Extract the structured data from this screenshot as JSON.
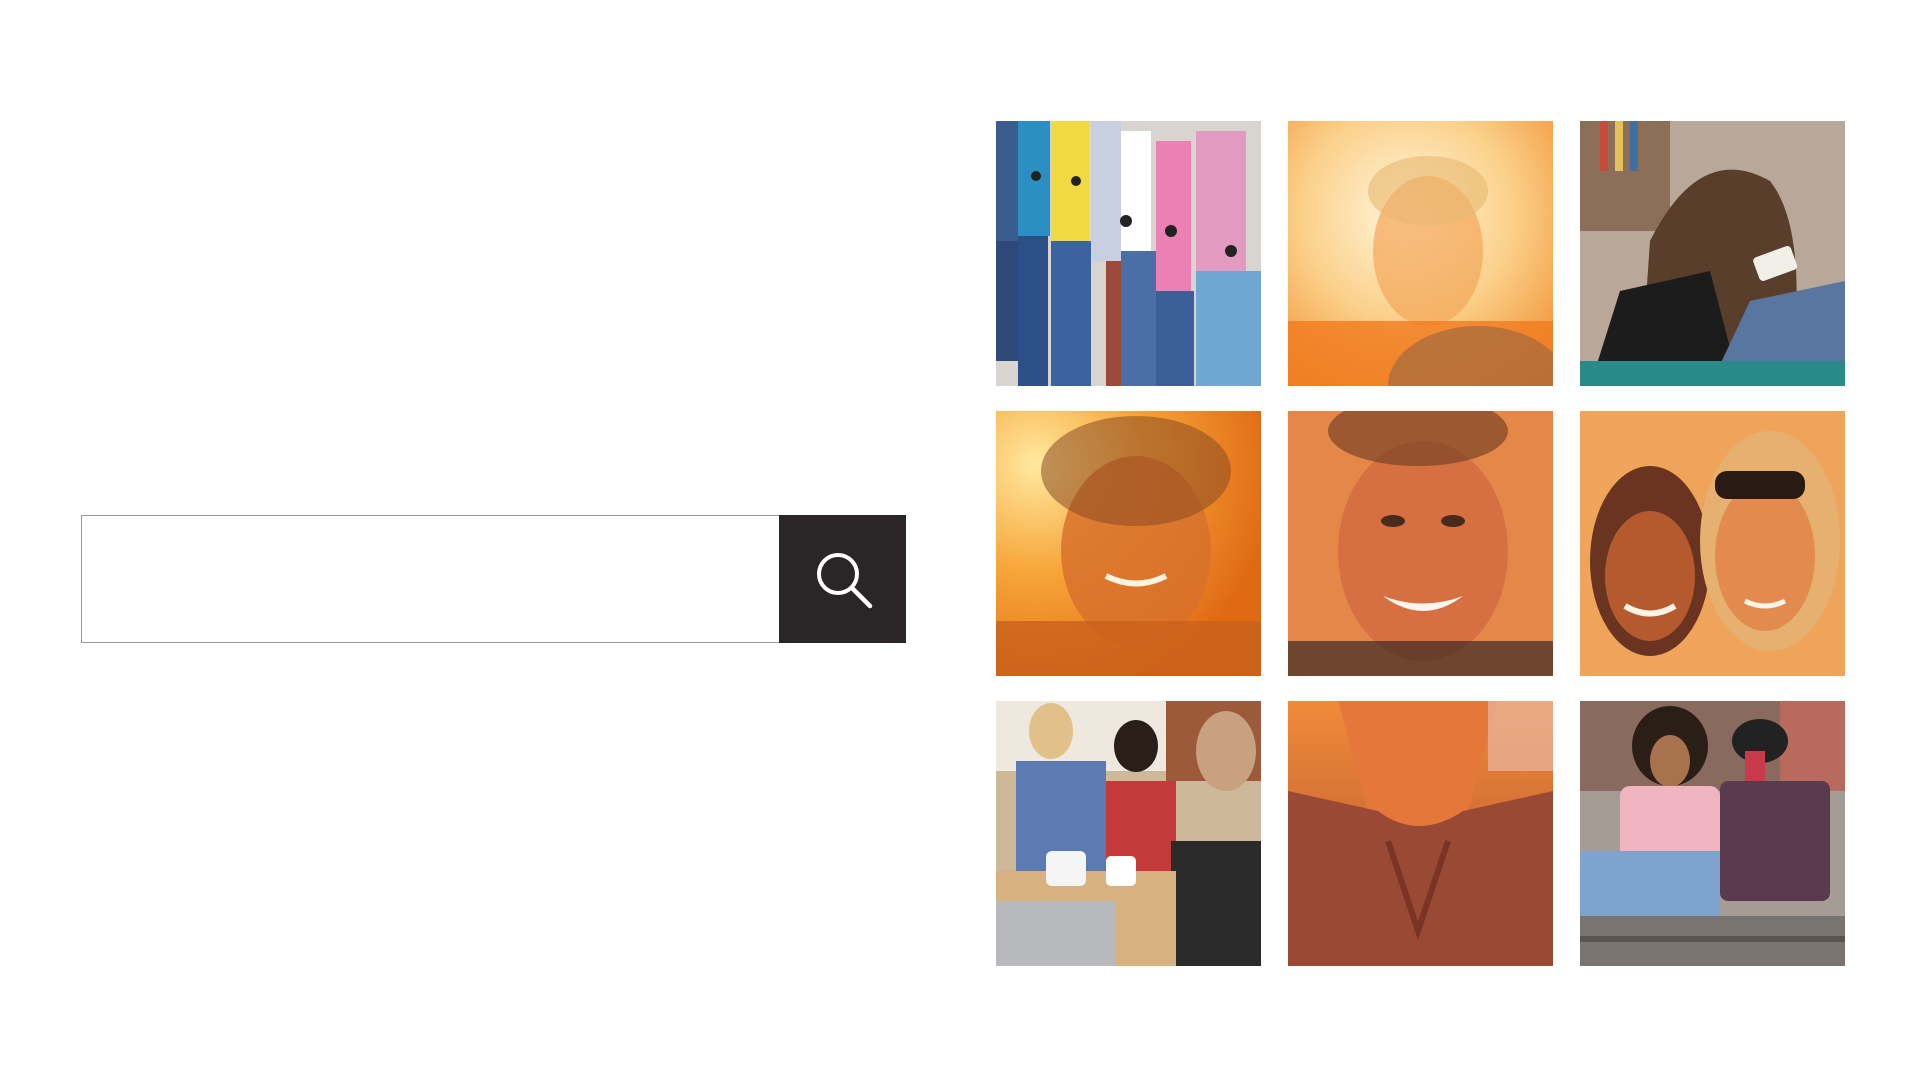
{
  "search": {
    "value": "",
    "placeholder": "",
    "button_icon": "search-icon",
    "button_color": "#2a2627"
  },
  "photos": [
    {
      "subject": "teens-with-phones-against-wall"
    },
    {
      "subject": "sunlit-selfie-man"
    },
    {
      "subject": "girl-looking-at-phone"
    },
    {
      "subject": "smiling-man-sun-flare"
    },
    {
      "subject": "smiling-man-selfie"
    },
    {
      "subject": "two-women-selfie"
    },
    {
      "subject": "family-at-table-with-devices"
    },
    {
      "subject": "man-close-up-orange"
    },
    {
      "subject": "two-girls-on-steps-with-phones"
    }
  ],
  "colors": {
    "background": "#ffffff",
    "warm_tint": "#f07a1e"
  }
}
